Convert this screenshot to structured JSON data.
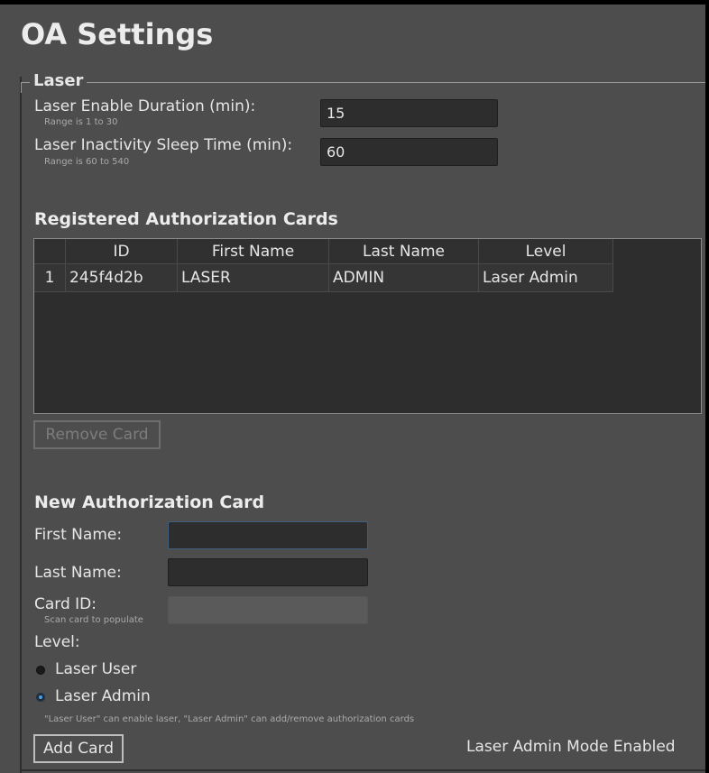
{
  "page": {
    "title": "OA Settings"
  },
  "laser": {
    "legend": "Laser",
    "enable_duration": {
      "label": "Laser Enable Duration (min):",
      "hint": "Range is 1 to 30",
      "value": "15"
    },
    "inactivity_sleep": {
      "label": "Laser Inactivity Sleep Time (min):",
      "hint": "Range is 60 to 540",
      "value": "60"
    }
  },
  "cards": {
    "heading": "Registered Authorization Cards",
    "columns": [
      "",
      "ID",
      "First Name",
      "Last Name",
      "Level"
    ],
    "rows": [
      [
        "1",
        "245f4d2b",
        "LASER",
        "ADMIN",
        "Laser Admin"
      ]
    ],
    "remove_button": "Remove Card"
  },
  "new_card": {
    "heading": "New Authorization Card",
    "first_name_label": "First Name:",
    "first_name_value": "",
    "last_name_label": "Last Name:",
    "last_name_value": "",
    "card_id_label": "Card ID:",
    "card_id_hint": "Scan card to populate",
    "card_id_value": "",
    "level_label": "Level:",
    "levels": [
      {
        "label": "Laser User",
        "selected": false
      },
      {
        "label": "Laser Admin",
        "selected": true
      }
    ],
    "level_note": "\"Laser User\" can enable laser, \"Laser Admin\" can add/remove authorization cards",
    "add_button": "Add Card"
  },
  "status": {
    "mode_text": "Laser Admin Mode Enabled"
  },
  "colors": {
    "background": "#4d4d4d",
    "field": "#2d2d2d",
    "focus_border": "#3f5f80",
    "radio_selected": "#4aa0e6"
  }
}
